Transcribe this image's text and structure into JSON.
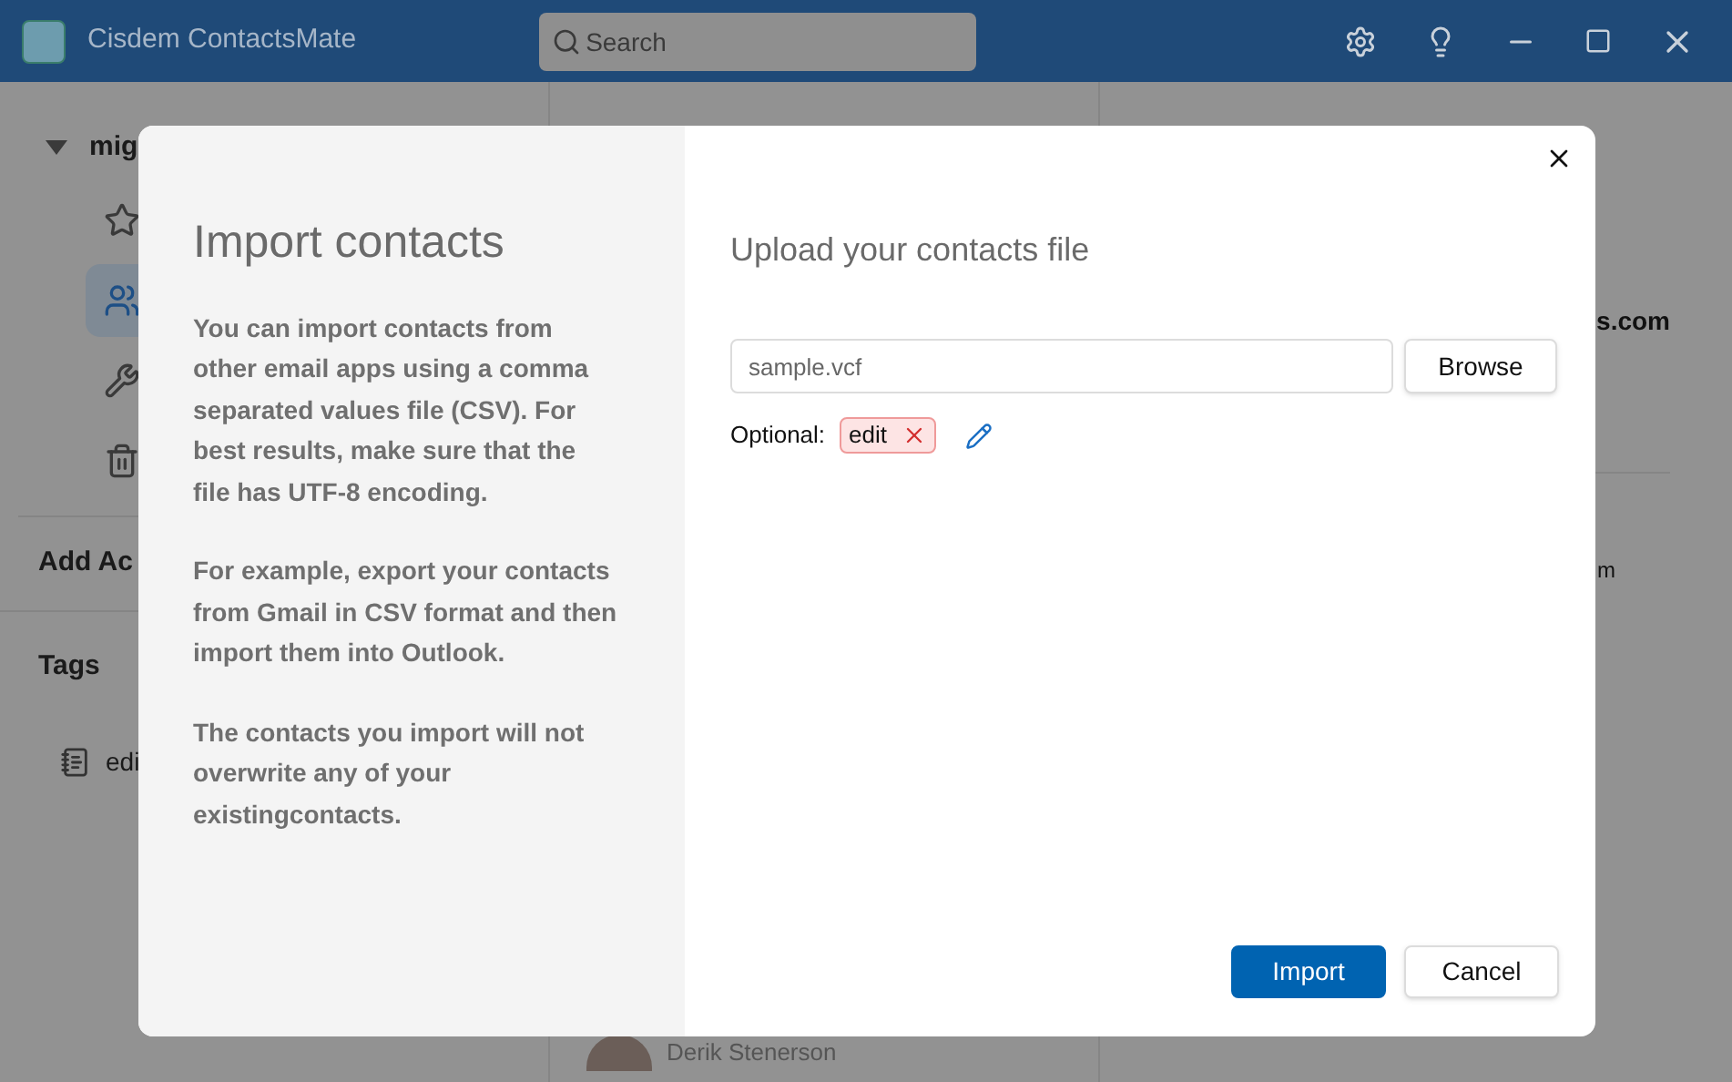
{
  "window": {
    "title": "Cisdem ContactsMate"
  },
  "search": {
    "placeholder": "Search"
  },
  "sidebar": {
    "account": {
      "name": "mig",
      "expanded": true
    },
    "items": [
      {
        "kind": "star",
        "selected": false
      },
      {
        "kind": "contacts",
        "selected": true
      },
      {
        "kind": "tools",
        "selected": false
      },
      {
        "kind": "trash",
        "selected": false
      }
    ],
    "add_account": "Add Ac",
    "tags_heading": "Tags",
    "tags": [
      "edi"
    ]
  },
  "list": {
    "contacts": [
      {
        "name": "Derik Stenerson"
      }
    ]
  },
  "details": {
    "email": "s.com",
    "field_2": "m"
  },
  "dialog": {
    "title": "Import contacts",
    "paragraphs": [
      "You can import contacts from other email apps using a comma separated values file (CSV). For best results, make sure that the file has UTF-8 encoding.",
      "For example, export your contacts from Gmail in CSV format and then import them into Outlook.",
      "The contacts you import will not overwrite any of your existingcontacts."
    ],
    "heading": "Upload your contacts file",
    "file": "sample.vcf",
    "browse": "Browse",
    "optional_label": "Optional:",
    "tags": [
      "edit"
    ],
    "buttons": [
      "Import",
      "Cancel"
    ]
  }
}
